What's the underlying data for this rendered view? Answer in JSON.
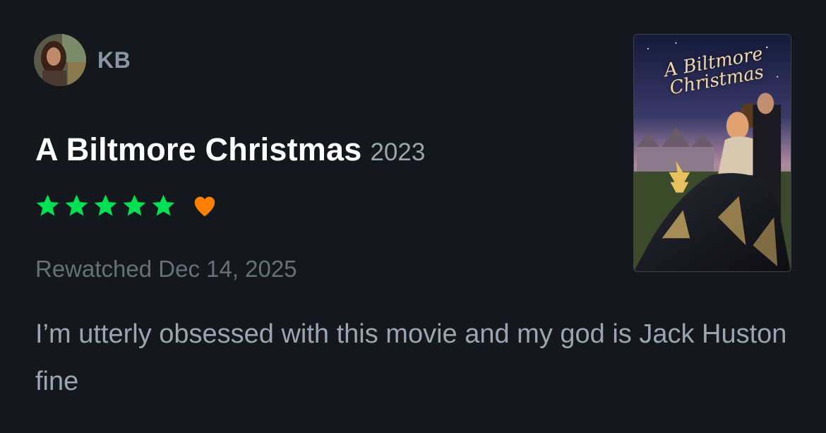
{
  "reviewer": {
    "name": "KB",
    "avatar_icon": "user-avatar"
  },
  "film": {
    "title": "A Biltmore Christmas",
    "year": "2023",
    "poster_title": "A Biltmore Christmas"
  },
  "rating": {
    "stars": 5,
    "max_stars": 5,
    "star_color": "#00e054",
    "liked": true,
    "heart_color": "#ff8000"
  },
  "watched": {
    "label": "Rewatched Dec 14, 2025"
  },
  "review": {
    "text": "I’m utterly obsessed with this movie and my god is Jack Huston fine"
  },
  "colors": {
    "background": "#14181c",
    "title": "#ffffff",
    "muted": "#9aa5b1"
  }
}
